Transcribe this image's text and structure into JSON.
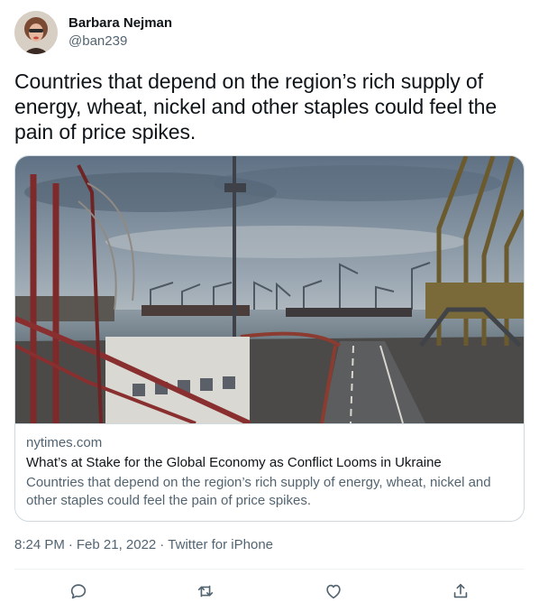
{
  "author": {
    "display_name": "Barbara Nejman",
    "handle": "@ban239"
  },
  "tweet": {
    "text": "Countries that depend on the region’s rich supply of energy, wheat, nickel and other staples could feel the pain of price spikes."
  },
  "card": {
    "domain": "nytimes.com",
    "title": "What’s at Stake for the Global Economy as Conflict Looms in Ukraine",
    "description": "Countries that depend on the region’s rich supply of energy, wheat, nickel and other staples could feel the pain of price spikes."
  },
  "meta": {
    "time": "8:24 PM",
    "separator": "·",
    "date": "Feb 21, 2022",
    "source": "Twitter for iPhone"
  },
  "actions": [
    {
      "icon": "reply-icon"
    },
    {
      "icon": "retweet-icon"
    },
    {
      "icon": "like-icon"
    },
    {
      "icon": "share-icon"
    }
  ],
  "colors": {
    "primary_text": "#0f1419",
    "secondary_text": "#536471",
    "border": "#cfd9de",
    "divider": "#eff3f4"
  }
}
